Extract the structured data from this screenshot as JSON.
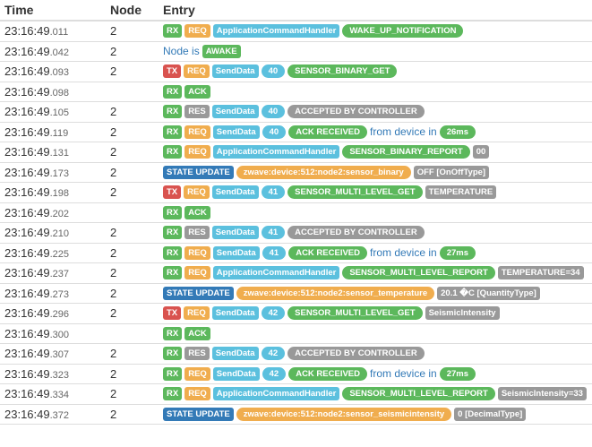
{
  "columns": {
    "time": "Time",
    "node": "Node",
    "entry": "Entry"
  },
  "colors": {
    "green": "#5cb85c",
    "red": "#d9534f",
    "orange": "#f0ad4e",
    "blue": "#337ab7",
    "lightblue": "#5bc0de",
    "gray": "#999999"
  },
  "rows": [
    {
      "time": "23:16:49",
      "ms": ".011",
      "node": "2",
      "entry": [
        {
          "kind": "label",
          "color": "green",
          "text": "RX"
        },
        {
          "kind": "label",
          "color": "orange",
          "text": "REQ"
        },
        {
          "kind": "label",
          "color": "lightblue",
          "text": "ApplicationCommandHandler"
        },
        {
          "kind": "pill",
          "color": "green",
          "text": "WAKE_UP_NOTIFICATION"
        }
      ]
    },
    {
      "time": "23:16:49",
      "ms": ".042",
      "node": "2",
      "entry": [
        {
          "kind": "text",
          "color": "blue",
          "text": "Node is"
        },
        {
          "kind": "label",
          "color": "green",
          "text": "AWAKE"
        }
      ]
    },
    {
      "time": "23:16:49",
      "ms": ".093",
      "node": "2",
      "entry": [
        {
          "kind": "label",
          "color": "red",
          "text": "TX"
        },
        {
          "kind": "label",
          "color": "orange",
          "text": "REQ"
        },
        {
          "kind": "label",
          "color": "lightblue",
          "text": "SendData"
        },
        {
          "kind": "pill",
          "color": "lightblue",
          "text": "40"
        },
        {
          "kind": "pill",
          "color": "green",
          "text": "SENSOR_BINARY_GET"
        }
      ]
    },
    {
      "time": "23:16:49",
      "ms": ".098",
      "node": "",
      "entry": [
        {
          "kind": "label",
          "color": "green",
          "text": "RX"
        },
        {
          "kind": "label",
          "color": "green",
          "text": "ACK"
        }
      ]
    },
    {
      "time": "23:16:49",
      "ms": ".105",
      "node": "2",
      "entry": [
        {
          "kind": "label",
          "color": "green",
          "text": "RX"
        },
        {
          "kind": "label",
          "color": "gray",
          "text": "RES"
        },
        {
          "kind": "label",
          "color": "lightblue",
          "text": "SendData"
        },
        {
          "kind": "pill",
          "color": "lightblue",
          "text": "40"
        },
        {
          "kind": "pill",
          "color": "gray",
          "text": "ACCEPTED BY CONTROLLER"
        }
      ]
    },
    {
      "time": "23:16:49",
      "ms": ".119",
      "node": "2",
      "entry": [
        {
          "kind": "label",
          "color": "green",
          "text": "RX"
        },
        {
          "kind": "label",
          "color": "orange",
          "text": "REQ"
        },
        {
          "kind": "label",
          "color": "lightblue",
          "text": "SendData"
        },
        {
          "kind": "pill",
          "color": "lightblue",
          "text": "40"
        },
        {
          "kind": "pill",
          "color": "green",
          "text": "ACK RECEIVED"
        },
        {
          "kind": "text",
          "color": "blue",
          "text": "from device in"
        },
        {
          "kind": "pill",
          "color": "green",
          "text": "26ms"
        }
      ]
    },
    {
      "time": "23:16:49",
      "ms": ".131",
      "node": "2",
      "entry": [
        {
          "kind": "label",
          "color": "green",
          "text": "RX"
        },
        {
          "kind": "label",
          "color": "orange",
          "text": "REQ"
        },
        {
          "kind": "label",
          "color": "lightblue",
          "text": "ApplicationCommandHandler"
        },
        {
          "kind": "pill",
          "color": "green",
          "text": "SENSOR_BINARY_REPORT"
        },
        {
          "kind": "label",
          "color": "gray",
          "text": "00"
        }
      ]
    },
    {
      "time": "23:16:49",
      "ms": ".173",
      "node": "2",
      "entry": [
        {
          "kind": "label",
          "color": "blue",
          "text": "STATE UPDATE"
        },
        {
          "kind": "pill",
          "color": "orange",
          "text": "zwave:device:512:node2:sensor_binary"
        },
        {
          "kind": "label",
          "color": "gray",
          "text": "OFF [OnOffType]"
        }
      ]
    },
    {
      "time": "23:16:49",
      "ms": ".198",
      "node": "2",
      "entry": [
        {
          "kind": "label",
          "color": "red",
          "text": "TX"
        },
        {
          "kind": "label",
          "color": "orange",
          "text": "REQ"
        },
        {
          "kind": "label",
          "color": "lightblue",
          "text": "SendData"
        },
        {
          "kind": "pill",
          "color": "lightblue",
          "text": "41"
        },
        {
          "kind": "pill",
          "color": "green",
          "text": "SENSOR_MULTI_LEVEL_GET"
        },
        {
          "kind": "label",
          "color": "gray",
          "text": "TEMPERATURE"
        }
      ]
    },
    {
      "time": "23:16:49",
      "ms": ".202",
      "node": "",
      "entry": [
        {
          "kind": "label",
          "color": "green",
          "text": "RX"
        },
        {
          "kind": "label",
          "color": "green",
          "text": "ACK"
        }
      ]
    },
    {
      "time": "23:16:49",
      "ms": ".210",
      "node": "2",
      "entry": [
        {
          "kind": "label",
          "color": "green",
          "text": "RX"
        },
        {
          "kind": "label",
          "color": "gray",
          "text": "RES"
        },
        {
          "kind": "label",
          "color": "lightblue",
          "text": "SendData"
        },
        {
          "kind": "pill",
          "color": "lightblue",
          "text": "41"
        },
        {
          "kind": "pill",
          "color": "gray",
          "text": "ACCEPTED BY CONTROLLER"
        }
      ]
    },
    {
      "time": "23:16:49",
      "ms": ".225",
      "node": "2",
      "entry": [
        {
          "kind": "label",
          "color": "green",
          "text": "RX"
        },
        {
          "kind": "label",
          "color": "orange",
          "text": "REQ"
        },
        {
          "kind": "label",
          "color": "lightblue",
          "text": "SendData"
        },
        {
          "kind": "pill",
          "color": "lightblue",
          "text": "41"
        },
        {
          "kind": "pill",
          "color": "green",
          "text": "ACK RECEIVED"
        },
        {
          "kind": "text",
          "color": "blue",
          "text": "from device in"
        },
        {
          "kind": "pill",
          "color": "green",
          "text": "27ms"
        }
      ]
    },
    {
      "time": "23:16:49",
      "ms": ".237",
      "node": "2",
      "entry": [
        {
          "kind": "label",
          "color": "green",
          "text": "RX"
        },
        {
          "kind": "label",
          "color": "orange",
          "text": "REQ"
        },
        {
          "kind": "label",
          "color": "lightblue",
          "text": "ApplicationCommandHandler"
        },
        {
          "kind": "pill",
          "color": "green",
          "text": "SENSOR_MULTI_LEVEL_REPORT"
        },
        {
          "kind": "label",
          "color": "gray",
          "text": "TEMPERATURE=34"
        }
      ]
    },
    {
      "time": "23:16:49",
      "ms": ".273",
      "node": "2",
      "entry": [
        {
          "kind": "label",
          "color": "blue",
          "text": "STATE UPDATE"
        },
        {
          "kind": "pill",
          "color": "orange",
          "text": "zwave:device:512:node2:sensor_temperature"
        },
        {
          "kind": "label",
          "color": "gray",
          "text": "20.1 �C [QuantityType]"
        }
      ]
    },
    {
      "time": "23:16:49",
      "ms": ".296",
      "node": "2",
      "entry": [
        {
          "kind": "label",
          "color": "red",
          "text": "TX"
        },
        {
          "kind": "label",
          "color": "orange",
          "text": "REQ"
        },
        {
          "kind": "label",
          "color": "lightblue",
          "text": "SendData"
        },
        {
          "kind": "pill",
          "color": "lightblue",
          "text": "42"
        },
        {
          "kind": "pill",
          "color": "green",
          "text": "SENSOR_MULTI_LEVEL_GET"
        },
        {
          "kind": "label",
          "color": "gray",
          "text": "SeismicIntensity"
        }
      ]
    },
    {
      "time": "23:16:49",
      "ms": ".300",
      "node": "",
      "entry": [
        {
          "kind": "label",
          "color": "green",
          "text": "RX"
        },
        {
          "kind": "label",
          "color": "green",
          "text": "ACK"
        }
      ]
    },
    {
      "time": "23:16:49",
      "ms": ".307",
      "node": "2",
      "entry": [
        {
          "kind": "label",
          "color": "green",
          "text": "RX"
        },
        {
          "kind": "label",
          "color": "gray",
          "text": "RES"
        },
        {
          "kind": "label",
          "color": "lightblue",
          "text": "SendData"
        },
        {
          "kind": "pill",
          "color": "lightblue",
          "text": "42"
        },
        {
          "kind": "pill",
          "color": "gray",
          "text": "ACCEPTED BY CONTROLLER"
        }
      ]
    },
    {
      "time": "23:16:49",
      "ms": ".323",
      "node": "2",
      "entry": [
        {
          "kind": "label",
          "color": "green",
          "text": "RX"
        },
        {
          "kind": "label",
          "color": "orange",
          "text": "REQ"
        },
        {
          "kind": "label",
          "color": "lightblue",
          "text": "SendData"
        },
        {
          "kind": "pill",
          "color": "lightblue",
          "text": "42"
        },
        {
          "kind": "pill",
          "color": "green",
          "text": "ACK RECEIVED"
        },
        {
          "kind": "text",
          "color": "blue",
          "text": "from device in"
        },
        {
          "kind": "pill",
          "color": "green",
          "text": "27ms"
        }
      ]
    },
    {
      "time": "23:16:49",
      "ms": ".334",
      "node": "2",
      "entry": [
        {
          "kind": "label",
          "color": "green",
          "text": "RX"
        },
        {
          "kind": "label",
          "color": "orange",
          "text": "REQ"
        },
        {
          "kind": "label",
          "color": "lightblue",
          "text": "ApplicationCommandHandler"
        },
        {
          "kind": "pill",
          "color": "green",
          "text": "SENSOR_MULTI_LEVEL_REPORT"
        },
        {
          "kind": "label",
          "color": "gray",
          "text": "SeismicIntensity=33"
        }
      ]
    },
    {
      "time": "23:16:49",
      "ms": ".372",
      "node": "2",
      "entry": [
        {
          "kind": "label",
          "color": "blue",
          "text": "STATE UPDATE"
        },
        {
          "kind": "pill",
          "color": "orange",
          "text": "zwave:device:512:node2:sensor_seismicintensity"
        },
        {
          "kind": "label",
          "color": "gray",
          "text": "0 [DecimalType]"
        }
      ]
    }
  ]
}
